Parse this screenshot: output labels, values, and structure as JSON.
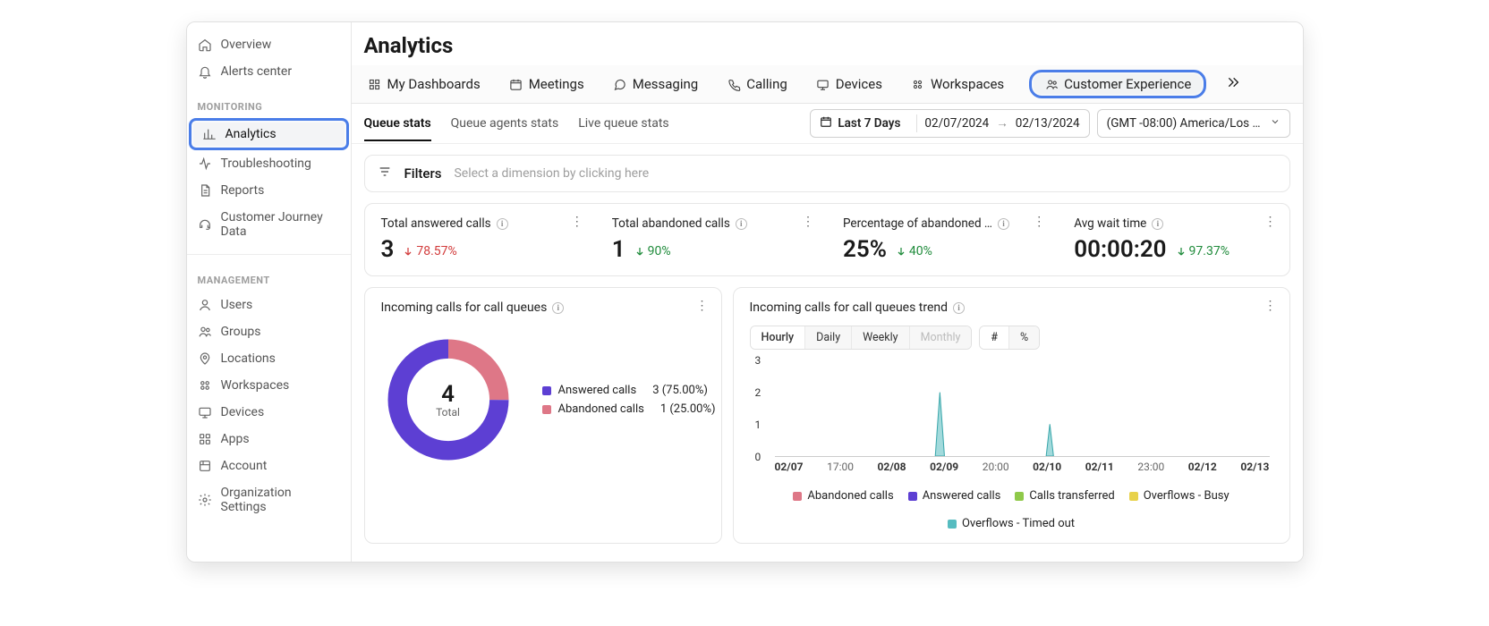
{
  "sidebar": {
    "top": [
      {
        "label": "Overview",
        "icon": "home"
      },
      {
        "label": "Alerts center",
        "icon": "bell"
      }
    ],
    "section1_title": "MONITORING",
    "section1": [
      {
        "label": "Analytics",
        "icon": "analytics",
        "active": true
      },
      {
        "label": "Troubleshooting",
        "icon": "activity"
      },
      {
        "label": "Reports",
        "icon": "doc"
      },
      {
        "label": "Customer Journey Data",
        "icon": "headset"
      }
    ],
    "section2_title": "MANAGEMENT",
    "section2": [
      {
        "label": "Users",
        "icon": "user"
      },
      {
        "label": "Groups",
        "icon": "users"
      },
      {
        "label": "Locations",
        "icon": "pin"
      },
      {
        "label": "Workspaces",
        "icon": "workspace"
      },
      {
        "label": "Devices",
        "icon": "device"
      },
      {
        "label": "Apps",
        "icon": "apps"
      },
      {
        "label": "Account",
        "icon": "account"
      },
      {
        "label": "Organization Settings",
        "icon": "gear"
      }
    ]
  },
  "page_title": "Analytics",
  "tabs": [
    {
      "label": "My Dashboards",
      "icon": "grid"
    },
    {
      "label": "Meetings",
      "icon": "calendar"
    },
    {
      "label": "Messaging",
      "icon": "chat"
    },
    {
      "label": "Calling",
      "icon": "phone"
    },
    {
      "label": "Devices",
      "icon": "device"
    },
    {
      "label": "Workspaces",
      "icon": "workspace"
    },
    {
      "label": "Customer Experience",
      "icon": "users",
      "highlighted": true
    }
  ],
  "subtabs": [
    {
      "label": "Queue stats",
      "active": true
    },
    {
      "label": "Queue agents stats"
    },
    {
      "label": "Live queue stats"
    }
  ],
  "date": {
    "label": "Last 7 Days",
    "start": "02/07/2024",
    "end": "02/13/2024",
    "tz": "(GMT -08:00) America/Los …"
  },
  "filter": {
    "label": "Filters",
    "placeholder": "Select a dimension by clicking here"
  },
  "kpis": [
    {
      "title": "Total answered calls",
      "value": "3",
      "delta": "78.57%",
      "dir": "down-red"
    },
    {
      "title": "Total abandoned calls",
      "value": "1",
      "delta": "90%",
      "dir": "down-green"
    },
    {
      "title": "Percentage of abandoned …",
      "value": "25%",
      "delta": "40%",
      "dir": "down-green"
    },
    {
      "title": "Avg wait time",
      "value": "00:00:20",
      "delta": "97.37%",
      "dir": "down-green"
    }
  ],
  "donut": {
    "title": "Incoming calls for call queues",
    "total_value": "4",
    "total_label": "Total",
    "legend": [
      {
        "label": "Answered calls",
        "value": "3 (75.00%)",
        "color": "purple"
      },
      {
        "label": "Abandoned calls",
        "value": "1 (25.00%)",
        "color": "pink"
      }
    ]
  },
  "trend": {
    "title": "Incoming calls for call queues trend",
    "time_group": [
      "Hourly",
      "Daily",
      "Weekly",
      "Monthly"
    ],
    "time_active": "Hourly",
    "time_disabled": "Monthly",
    "value_group": [
      "#",
      "%"
    ],
    "value_active": "#",
    "y_ticks": [
      "3",
      "2",
      "1",
      "0"
    ],
    "x_ticks": [
      {
        "label": "02/07",
        "bold": true
      },
      {
        "label": "17:00",
        "bold": false
      },
      {
        "label": "02/08",
        "bold": true
      },
      {
        "label": "02/09",
        "bold": true
      },
      {
        "label": "20:00",
        "bold": false
      },
      {
        "label": "02/10",
        "bold": true
      },
      {
        "label": "02/11",
        "bold": true
      },
      {
        "label": "23:00",
        "bold": false
      },
      {
        "label": "02/12",
        "bold": true
      },
      {
        "label": "02/13",
        "bold": true
      }
    ],
    "legend": [
      {
        "label": "Abandoned calls",
        "color": "pink"
      },
      {
        "label": "Answered calls",
        "color": "purple"
      },
      {
        "label": "Calls transferred",
        "color": "green"
      },
      {
        "label": "Overflows - Busy",
        "color": "yellow"
      },
      {
        "label": "Overflows - Timed out",
        "color": "teal"
      }
    ]
  },
  "chart_data": [
    {
      "type": "pie",
      "title": "Incoming calls for call queues",
      "categories": [
        "Answered calls",
        "Abandoned calls"
      ],
      "values": [
        3,
        1
      ],
      "total": 4
    },
    {
      "type": "area",
      "title": "Incoming calls for call queues trend",
      "xlabel": "",
      "ylabel": "",
      "ylim": [
        0,
        3
      ],
      "x": [
        "02/07",
        "17:00",
        "02/08",
        "02/09",
        "20:00",
        "02/10",
        "02/11",
        "23:00",
        "02/12",
        "02/13"
      ],
      "series": [
        {
          "name": "Abandoned calls",
          "values": [
            0,
            0,
            0,
            0,
            0,
            0,
            0,
            0,
            0,
            0
          ]
        },
        {
          "name": "Answered calls",
          "values": [
            0,
            0,
            0,
            0,
            0,
            0,
            0,
            0,
            0,
            0
          ]
        },
        {
          "name": "Calls transferred",
          "values": [
            0,
            0,
            0,
            0,
            0,
            0,
            0,
            0,
            0,
            0
          ]
        },
        {
          "name": "Overflows - Busy",
          "values": [
            0,
            0,
            0,
            0,
            0,
            0,
            0,
            0,
            0,
            0
          ]
        },
        {
          "name": "Overflows - Timed out",
          "values": [
            0,
            0,
            0,
            2,
            0,
            1,
            0,
            0,
            0,
            0
          ]
        }
      ]
    }
  ]
}
